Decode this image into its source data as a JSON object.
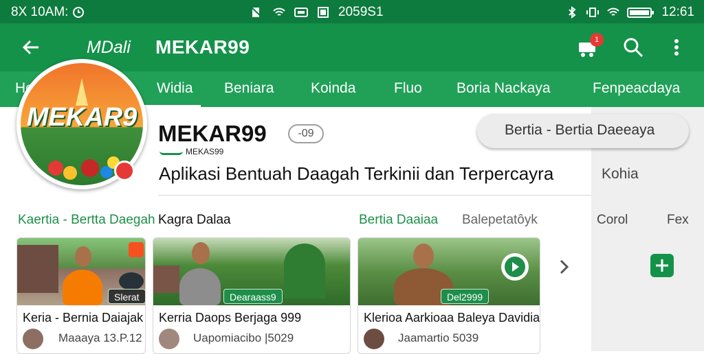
{
  "status_bar": {
    "left_text": "8X 10AM:",
    "center_text": "2059S1",
    "time": "12:61"
  },
  "app_bar": {
    "brand_small": "MDali",
    "brand": "MEKAR99",
    "cart_badge": "1"
  },
  "tabs": [
    {
      "label": "Hel"
    },
    {
      "label": "Widia"
    },
    {
      "label": "Beniara"
    },
    {
      "label": "Koinda"
    },
    {
      "label": "Fluo"
    },
    {
      "label": "Boria Nackaya"
    },
    {
      "label": "Fenpeacdaya"
    }
  ],
  "profile": {
    "logo_text": "MEKAR9",
    "title": "MEKAR99",
    "pill": "-09",
    "mini_brand": "MEKAS99",
    "subtitle": "Aplikasi  Bentuah Daagah Terkinii dan Terpercayra"
  },
  "side": {
    "search_label": "Bertia - Bertia Daeeaya",
    "kota": "Kohia",
    "col1": "Corol",
    "col2": "Fex"
  },
  "sections": [
    {
      "label": "Kaertia - Bertta Daegah",
      "color": "#1e8e4a"
    },
    {
      "label": "Kagra Dalaa",
      "color": "#111111"
    },
    {
      "label": "Bertia Daaiaa",
      "color": "#1e8e4a"
    },
    {
      "label": "Balepetatôyk",
      "color": "#666666"
    }
  ],
  "cards": [
    {
      "tag": "Slerat",
      "title": "Keria - Bernia Daiajak",
      "author": "Maaaya 13.P.12"
    },
    {
      "tag": "Dearaass9",
      "title": "Kerria Daops Berjaga 999",
      "author": "Uapomiacibo |5029"
    },
    {
      "tag": "Del2999",
      "title": "Klerioa Aarkioaa Baleya Davidia",
      "author": "Jaamartio 5039"
    }
  ],
  "colors": {
    "status_bar": "#0d7a3e",
    "app_bar": "#14924a",
    "tab_bar": "#21a058",
    "accent_red": "#e53935"
  },
  "icons": [
    "back-arrow-icon",
    "cart-icon",
    "search-icon",
    "more-vert-icon",
    "chevron-right-icon",
    "play-icon",
    "add-icon"
  ]
}
